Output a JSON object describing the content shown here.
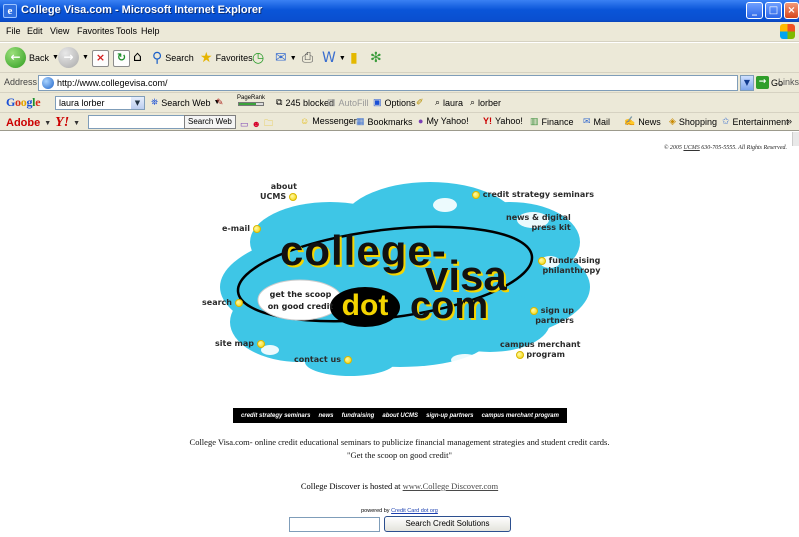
{
  "window": {
    "title": "College Visa.com - Microsoft Internet Explorer"
  },
  "menu": [
    "File",
    "Edit",
    "View",
    "Favorites",
    "Tools",
    "Help"
  ],
  "nav_toolbar": {
    "back": "Back",
    "search": "Search",
    "favorites": "Favorites"
  },
  "address_bar": {
    "label": "Address",
    "url": "http://www.collegevisa.com/",
    "go": "Go",
    "links": "Links"
  },
  "google_toolbar": {
    "logo": "Google",
    "query": "laura lorber",
    "search_web": "Search Web",
    "pagerank": "PageRank",
    "blocked": "245 blocked",
    "autofill": "AutoFill",
    "options": "Options",
    "term1": "laura",
    "term2": "lorber"
  },
  "yahoo_toolbar": {
    "adobe": "Adobe",
    "yahoo_logo": "Y!",
    "search_web": "Search Web",
    "items": [
      "Messenger",
      "Bookmarks",
      "My Yahoo!",
      "Yahoo!",
      "Finance",
      "Mail",
      "News",
      "Shopping",
      "Entertainment"
    ],
    "more": "»"
  },
  "copyright": {
    "prefix": "© 2005 ",
    "link": "UCMS",
    "suffix": " 630-705-5555. All Rights Reserved."
  },
  "hero": {
    "logo_line1": "college-",
    "logo_line2": "visa",
    "logo_dot": "dot",
    "logo_com": "com",
    "tagline1": "get the scoop",
    "tagline2": "on good credit",
    "links": {
      "about1": "about",
      "about2": "UCMS",
      "email": "e-mail",
      "search": "search",
      "sitemap": "site map",
      "contact": "contact us",
      "seminars": "credit strategy seminars",
      "news1": "news & digital",
      "news2": "press kit",
      "fund1": "fundraising",
      "fund2": "philanthropy",
      "signup1": "sign up",
      "signup2": "partners",
      "campus1": "campus merchant",
      "campus2": "program"
    }
  },
  "navbar": [
    "credit strategy seminars",
    "news",
    "fundraising",
    "about UCMS",
    "sign-up partners",
    "campus merchant program"
  ],
  "description": {
    "line1": "College Visa.com- online credit educational seminars to publicize financial management strategies and student credit cards.",
    "line2": "\"Get the scoop on good credit\""
  },
  "hosted": {
    "text": "College Discover is hosted at ",
    "link": "www.College Discover.com"
  },
  "powered": {
    "text": "powered by ",
    "link": "Credit Card dot org"
  },
  "search_box": {
    "value": "",
    "button": "Search Credit Solutions"
  },
  "colors": {
    "cloud": "#3ec6e6",
    "accent_yellow": "#f4d400",
    "title_bar": "#0a55d8"
  }
}
